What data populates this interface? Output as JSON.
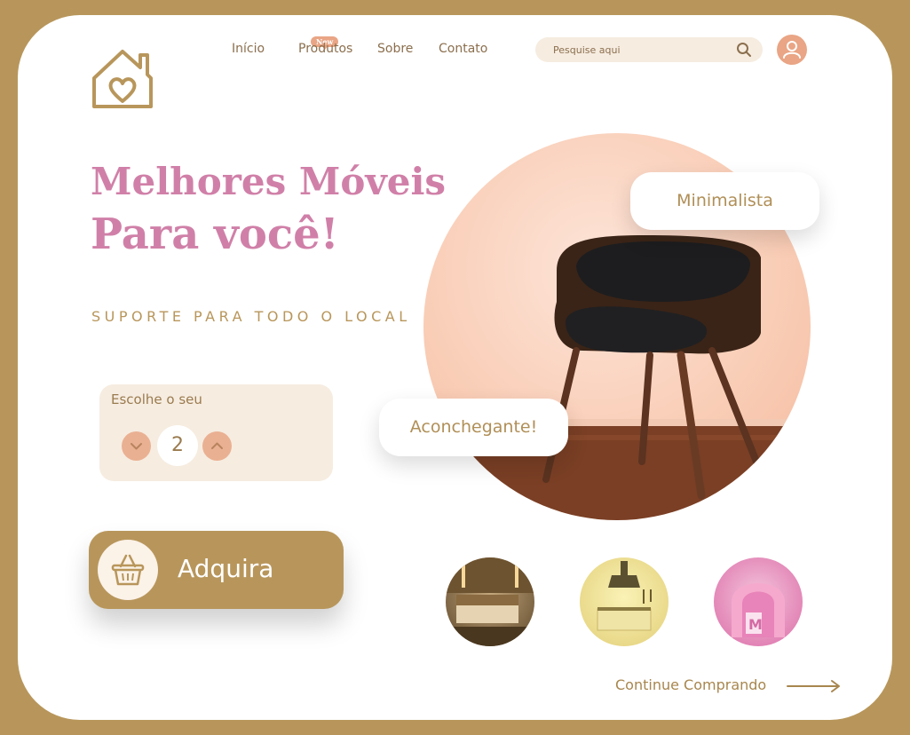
{
  "nav": {
    "items": [
      "Início",
      "Produtos",
      "Sobre",
      "Contato"
    ],
    "badge": "New"
  },
  "search": {
    "placeholder": "Pesquise aqui"
  },
  "hero": {
    "title_line1": "Melhores Móveis",
    "title_line2": "Para você!",
    "tagline": "SUPORTE PARA TODO O LOCAL"
  },
  "quantity": {
    "label": "Escolhe o seu",
    "value": "2"
  },
  "buy_button": {
    "label": "Adquira"
  },
  "tags": {
    "minimal": "Minimalista",
    "cozy": "Aconchegante!"
  },
  "continue": {
    "label": "Continue Comprando"
  },
  "colors": {
    "brand": "#b8965b",
    "accent_pink": "#d080a8",
    "peach": "#e9a585",
    "cream": "#f6ece0"
  },
  "icons": [
    "house-heart-logo",
    "search-icon",
    "user-icon",
    "chevron-down-icon",
    "chevron-up-icon",
    "basket-icon",
    "arrow-right-icon"
  ]
}
